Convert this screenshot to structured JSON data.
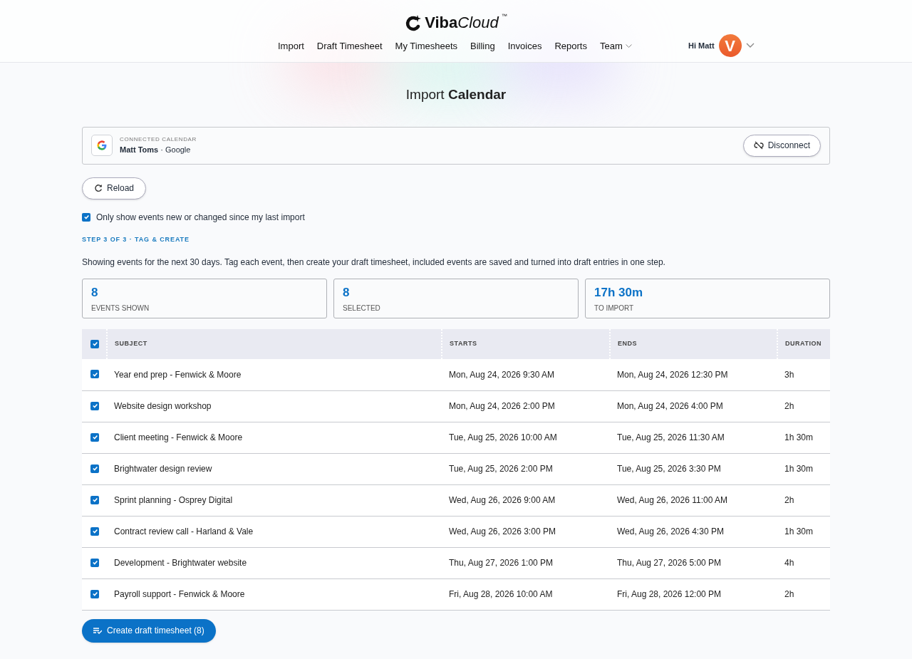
{
  "brand": {
    "bold": "Viba",
    "light": "Cloud",
    "mark": "™"
  },
  "nav": [
    {
      "label": "Import",
      "dropdown": false
    },
    {
      "label": "Draft Timesheet",
      "dropdown": false
    },
    {
      "label": "My Timesheets",
      "dropdown": false
    },
    {
      "label": "Billing",
      "dropdown": false
    },
    {
      "label": "Invoices",
      "dropdown": false
    },
    {
      "label": "Reports",
      "dropdown": false
    },
    {
      "label": "Team",
      "dropdown": true
    }
  ],
  "user": {
    "greeting": "Hi Matt",
    "avatar": "V"
  },
  "title": "Import **Calendar**",
  "connection": {
    "caption": "CONNECTED CALENDAR",
    "account": "**Matt Toms** · Google",
    "button": "Disconnect"
  },
  "reload_button": "Reload",
  "filter": {
    "label": "Only show events new or changed since my last import",
    "checked": true
  },
  "step": "STEP 3 OF 3 · TAG & CREATE",
  "description": "Showing events for the next 30 days. Tag each event, then create your draft timesheet, included events are saved and turned into draft entries in one step.",
  "stats": [
    {
      "value": "8",
      "label": "EVENTS SHOWN"
    },
    {
      "value": "8",
      "label": "SELECTED"
    },
    {
      "value": "17h 30m",
      "label": "TO IMPORT"
    }
  ],
  "table": {
    "all_checked": true,
    "columns": [
      "SUBJECT",
      "STARTS",
      "ENDS",
      "DURATION"
    ],
    "rows": [
      {
        "checked": true,
        "subject": "Year end prep - Fenwick & Moore",
        "starts": "Mon, Aug 24, 2026 9:30 AM",
        "ends": "Mon, Aug 24, 2026 12:30 PM",
        "duration": "3h"
      },
      {
        "checked": true,
        "subject": "Website design workshop",
        "starts": "Mon, Aug 24, 2026 2:00 PM",
        "ends": "Mon, Aug 24, 2026 4:00 PM",
        "duration": "2h"
      },
      {
        "checked": true,
        "subject": "Client meeting - Fenwick & Moore",
        "starts": "Tue, Aug 25, 2026 10:00 AM",
        "ends": "Tue, Aug 25, 2026 11:30 AM",
        "duration": "1h 30m"
      },
      {
        "checked": true,
        "subject": "Brightwater design review",
        "starts": "Tue, Aug 25, 2026 2:00 PM",
        "ends": "Tue, Aug 25, 2026 3:30 PM",
        "duration": "1h 30m"
      },
      {
        "checked": true,
        "subject": "Sprint planning - Osprey Digital",
        "starts": "Wed, Aug 26, 2026 9:00 AM",
        "ends": "Wed, Aug 26, 2026 11:00 AM",
        "duration": "2h"
      },
      {
        "checked": true,
        "subject": "Contract review call - Harland & Vale",
        "starts": "Wed, Aug 26, 2026 3:00 PM",
        "ends": "Wed, Aug 26, 2026 4:30 PM",
        "duration": "1h 30m"
      },
      {
        "checked": true,
        "subject": "Development - Brightwater website",
        "starts": "Thu, Aug 27, 2026 1:00 PM",
        "ends": "Thu, Aug 27, 2026 5:00 PM",
        "duration": "4h"
      },
      {
        "checked": true,
        "subject": "Payroll support - Fenwick & Moore",
        "starts": "Fri, Aug 28, 2026 10:00 AM",
        "ends": "Fri, Aug 28, 2026 12:00 PM",
        "duration": "2h"
      }
    ]
  },
  "create_button": "Create draft timesheet (8)"
}
